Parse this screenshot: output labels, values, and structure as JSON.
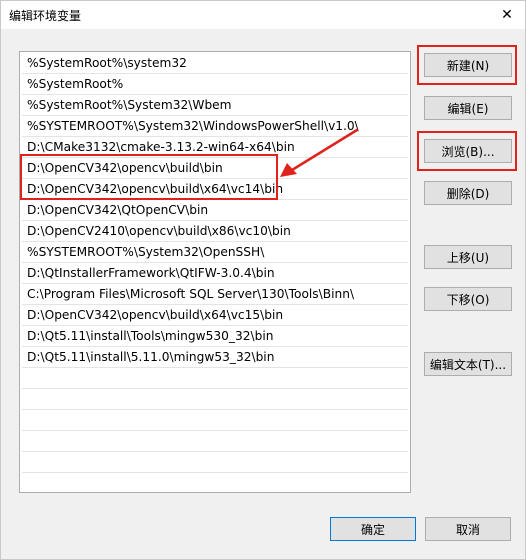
{
  "window": {
    "title": "编辑环境变量",
    "close_glyph": "✕"
  },
  "paths": [
    "%SystemRoot%\\system32",
    "%SystemRoot%",
    "%SystemRoot%\\System32\\Wbem",
    "%SYSTEMROOT%\\System32\\WindowsPowerShell\\v1.0\\",
    "D:\\CMake3132\\cmake-3.13.2-win64-x64\\bin",
    "D:\\OpenCV342\\opencv\\build\\bin",
    "D:\\OpenCV342\\opencv\\build\\x64\\vc14\\bin",
    "D:\\OpenCV342\\QtOpenCV\\bin",
    "D:\\OpenCV2410\\opencv\\build\\x86\\vc10\\bin",
    "%SYSTEMROOT%\\System32\\OpenSSH\\",
    "D:\\QtInstallerFramework\\QtIFW-3.0.4\\bin",
    "C:\\Program Files\\Microsoft SQL Server\\130\\Tools\\Binn\\",
    "D:\\OpenCV342\\opencv\\build\\x64\\vc15\\bin",
    "D:\\Qt5.11\\install\\Tools\\mingw530_32\\bin",
    "D:\\Qt5.11\\install\\5.11.0\\mingw53_32\\bin"
  ],
  "buttons": {
    "new": "新建(N)",
    "edit": "编辑(E)",
    "browse": "浏览(B)...",
    "delete": "删除(D)",
    "move_up": "上移(U)",
    "move_down": "下移(O)",
    "edit_text": "编辑文本(T)...",
    "ok": "确定",
    "cancel": "取消"
  },
  "colors": {
    "annotation": "#e0221c",
    "default_button_border": "#0078d7"
  }
}
